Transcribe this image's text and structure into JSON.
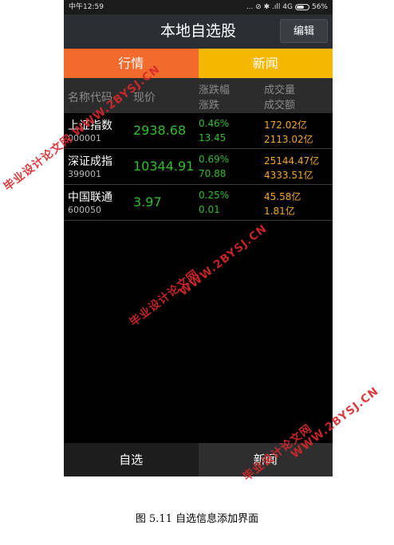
{
  "status_bar": {
    "time": "中午12:59",
    "indicators": "... ⊘ ✱ .ıll 4G",
    "battery": "56%"
  },
  "header": {
    "title": "本地自选股",
    "edit_label": "编辑"
  },
  "tabs": [
    {
      "label": "行情",
      "color": "#f36b2c"
    },
    {
      "label": "新闻",
      "color": "#f5b700"
    }
  ],
  "columns": {
    "name": "名称代码",
    "price": "现价",
    "change_pct": "涨跌幅",
    "change": "涨跌",
    "volume": "成交量",
    "amount": "成交额"
  },
  "stocks": [
    {
      "name": "上证指数",
      "code": "000001",
      "price": "2938.68",
      "change_pct": "0.46%",
      "change": "13.45",
      "volume": "172.02亿",
      "amount": "2113.02亿"
    },
    {
      "name": "深证成指",
      "code": "399001",
      "price": "10344.91",
      "change_pct": "0.69%",
      "change": "70.88",
      "volume": "25144.47亿",
      "amount": "4333.51亿"
    },
    {
      "name": "中国联通",
      "code": "600050",
      "price": "3.97",
      "change_pct": "0.25%",
      "change": "0.01",
      "volume": "45.58亿",
      "amount": "1.81亿"
    }
  ],
  "bottom_nav": [
    {
      "label": "自选"
    },
    {
      "label": "新闻"
    }
  ],
  "caption": "图 5.11 自选信息添加界面",
  "watermarks": [
    "毕业设计论文网",
    "WWW.2BYSJ.CN"
  ],
  "colors": {
    "up_green": "#2dbd2d",
    "volume_orange": "#f5a623",
    "watermark_red": "#d6282b"
  }
}
